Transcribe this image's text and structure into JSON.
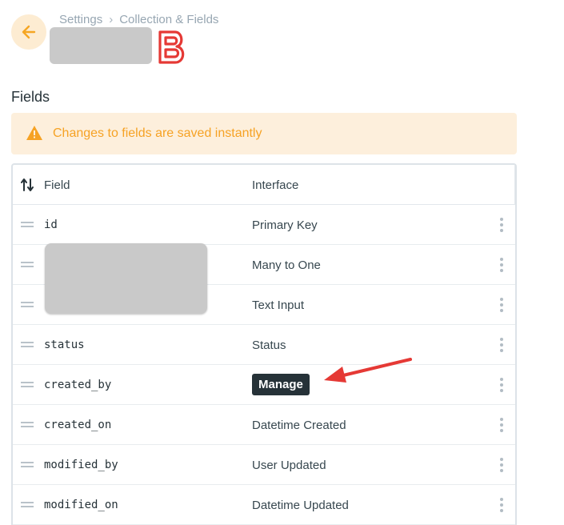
{
  "breadcrumb": {
    "items": [
      "Settings",
      "Collection & Fields"
    ],
    "separator": "›"
  },
  "header": {
    "back_icon": "arrow-left-icon",
    "brand_logo_icon": "letter-b-logo-icon",
    "brand_color": "#e53935"
  },
  "section": {
    "title": "Fields"
  },
  "notice": {
    "icon": "warning-triangle-icon",
    "text": "Changes to fields are saved instantly",
    "color": "#f6a224"
  },
  "table": {
    "sort_icon": "sort-arrows-icon",
    "columns": [
      "Field",
      "Interface"
    ],
    "rows": [
      {
        "field": "id",
        "interface": "Primary Key"
      },
      {
        "field": "",
        "interface": "Many to One"
      },
      {
        "field": "",
        "interface": "Text Input"
      },
      {
        "field": "status",
        "interface": "Status"
      },
      {
        "field": "created_by",
        "interface": "",
        "tooltip": "Manage"
      },
      {
        "field": "created_on",
        "interface": "Datetime Created"
      },
      {
        "field": "modified_by",
        "interface": "User Updated"
      },
      {
        "field": "modified_on",
        "interface": "Datetime Updated"
      }
    ]
  },
  "annotation": {
    "arrow_color": "#e53935"
  }
}
